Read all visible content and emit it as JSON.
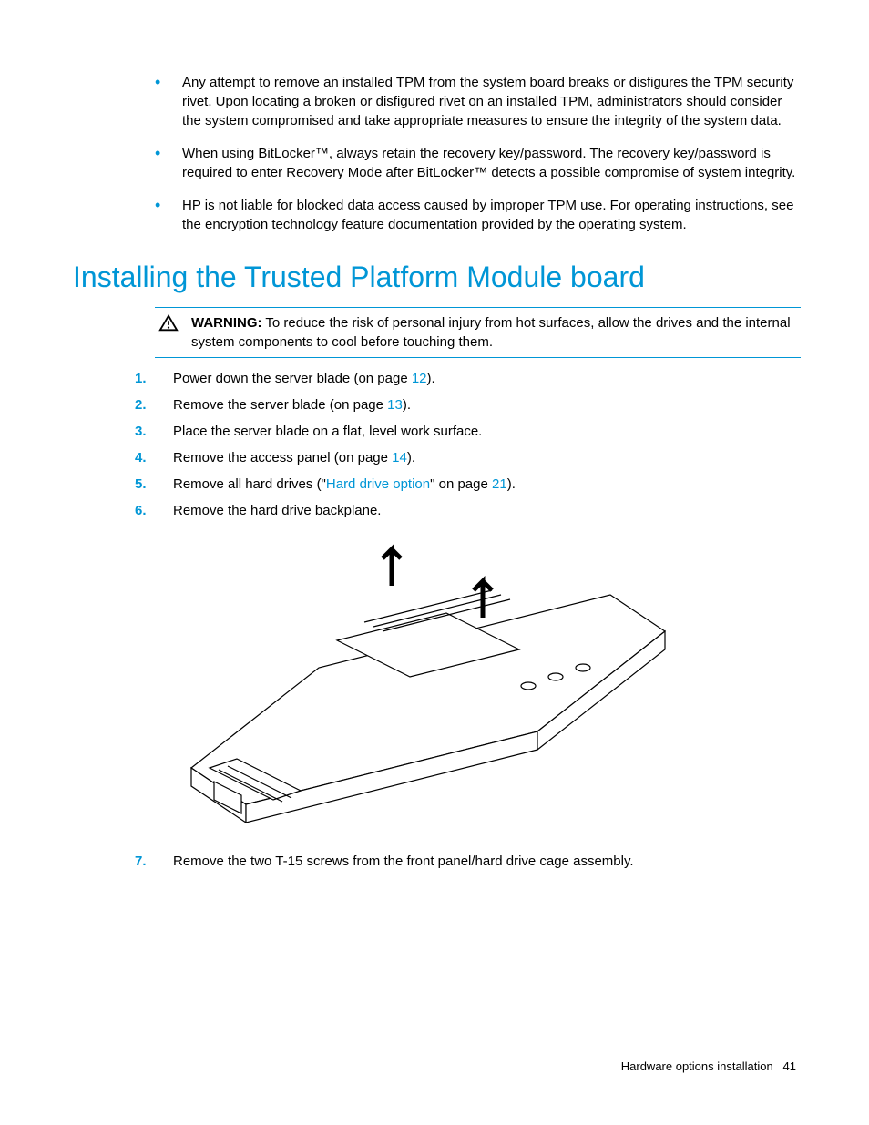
{
  "bullets": [
    "Any attempt to remove an installed TPM from the system board breaks or disfigures the TPM security rivet. Upon locating a broken or disfigured rivet on an installed TPM, administrators should consider the system compromised and take appropriate measures to ensure the integrity of the system data.",
    "When using BitLocker™, always retain the recovery key/password. The recovery key/password is required to enter Recovery Mode after BitLocker™ detects a possible compromise of system integrity.",
    "HP is not liable for blocked data access caused by improper TPM use. For operating instructions, see the encryption technology feature documentation provided by the operating system."
  ],
  "heading": "Installing the Trusted Platform Module board",
  "warning": {
    "label": "WARNING:",
    "text": "To reduce the risk of personal injury from hot surfaces, allow the drives and the internal system components to cool before touching them."
  },
  "steps": [
    {
      "num": "1.",
      "pre": "Power down the server blade (on page ",
      "link": "12",
      "post": ")."
    },
    {
      "num": "2.",
      "pre": "Remove the server blade (on page ",
      "link": "13",
      "post": ")."
    },
    {
      "num": "3.",
      "pre": "Place the server blade on a flat, level work surface.",
      "link": "",
      "post": ""
    },
    {
      "num": "4.",
      "pre": "Remove the access panel (on page ",
      "link": "14",
      "post": ")."
    },
    {
      "num": "5.",
      "pre": "Remove all hard drives (\"",
      "linkText": "Hard drive option",
      "mid": "\" on page ",
      "link": "21",
      "post": ")."
    },
    {
      "num": "6.",
      "pre": "Remove the hard drive backplane.",
      "link": "",
      "post": ""
    },
    {
      "num": "7.",
      "pre": "Remove the two T-15 screws from the front panel/hard drive cage assembly.",
      "link": "",
      "post": ""
    }
  ],
  "footer": {
    "section": "Hardware options installation",
    "page": "41"
  }
}
